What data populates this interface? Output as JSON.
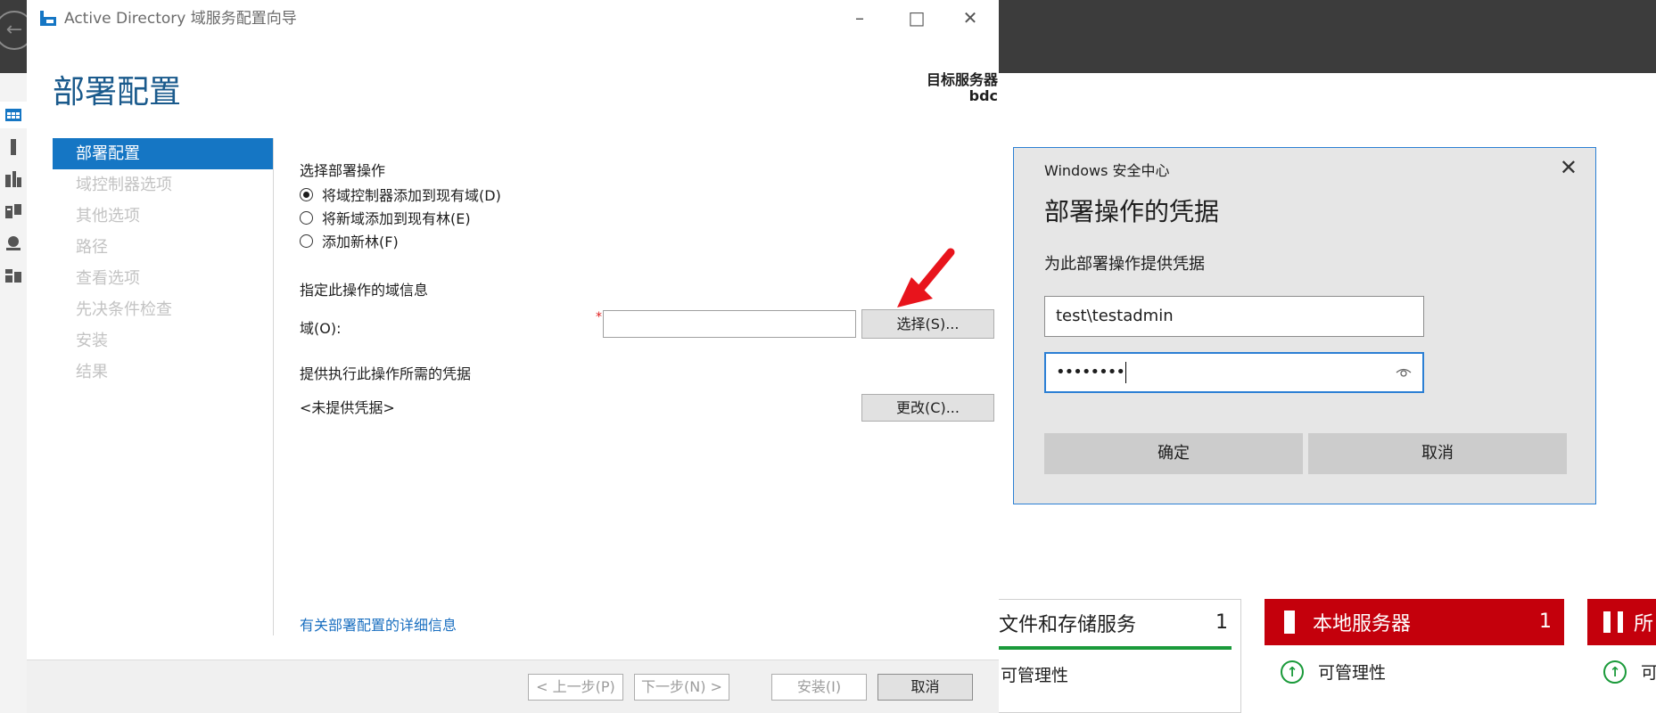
{
  "server_manager": {
    "tiles": [
      {
        "title": "文件和存储服务",
        "count": "1",
        "row": "可管理性"
      },
      {
        "title": "本地服务器",
        "count": "1",
        "row": "可管理性"
      },
      {
        "title": "所",
        "row": "可"
      }
    ],
    "colors": {
      "tile_red": "#c4000c",
      "status_green": "#1a9a3a",
      "topbar": "#3c3c3c"
    }
  },
  "wizard": {
    "title": "Active Directory 域服务配置向导",
    "heading": "部署配置",
    "target_label": "目标服务器",
    "target_name": "bdc",
    "steps": [
      "部署配置",
      "域控制器选项",
      "其他选项",
      "路径",
      "查看选项",
      "先决条件检查",
      "安装",
      "结果"
    ],
    "section_operation": "选择部署操作",
    "radios": [
      "将域控制器添加到现有域(D)",
      "将新域添加到现有林(E)",
      "添加新林(F)"
    ],
    "section_domain": "指定此操作的域信息",
    "domain_label": "域(O):",
    "domain_required": "*",
    "domain_value": "",
    "select_button": "选择(S)...",
    "section_credentials": "提供执行此操作所需的凭据",
    "no_credentials": "<未提供凭据>",
    "change_button": "更改(C)...",
    "more_info_link": "有关部署配置的详细信息",
    "footer": {
      "prev": "< 上一步(P)",
      "next": "下一步(N) >",
      "install": "安装(I)",
      "cancel": "取消"
    },
    "accent": "#1576c4"
  },
  "security_dialog": {
    "app": "Windows 安全中心",
    "title": "部署操作的凭据",
    "subtitle": "为此部署操作提供凭据",
    "username": "test\\testadmin",
    "password_mask": "••••••••",
    "ok": "确定",
    "cancel": "取消"
  }
}
